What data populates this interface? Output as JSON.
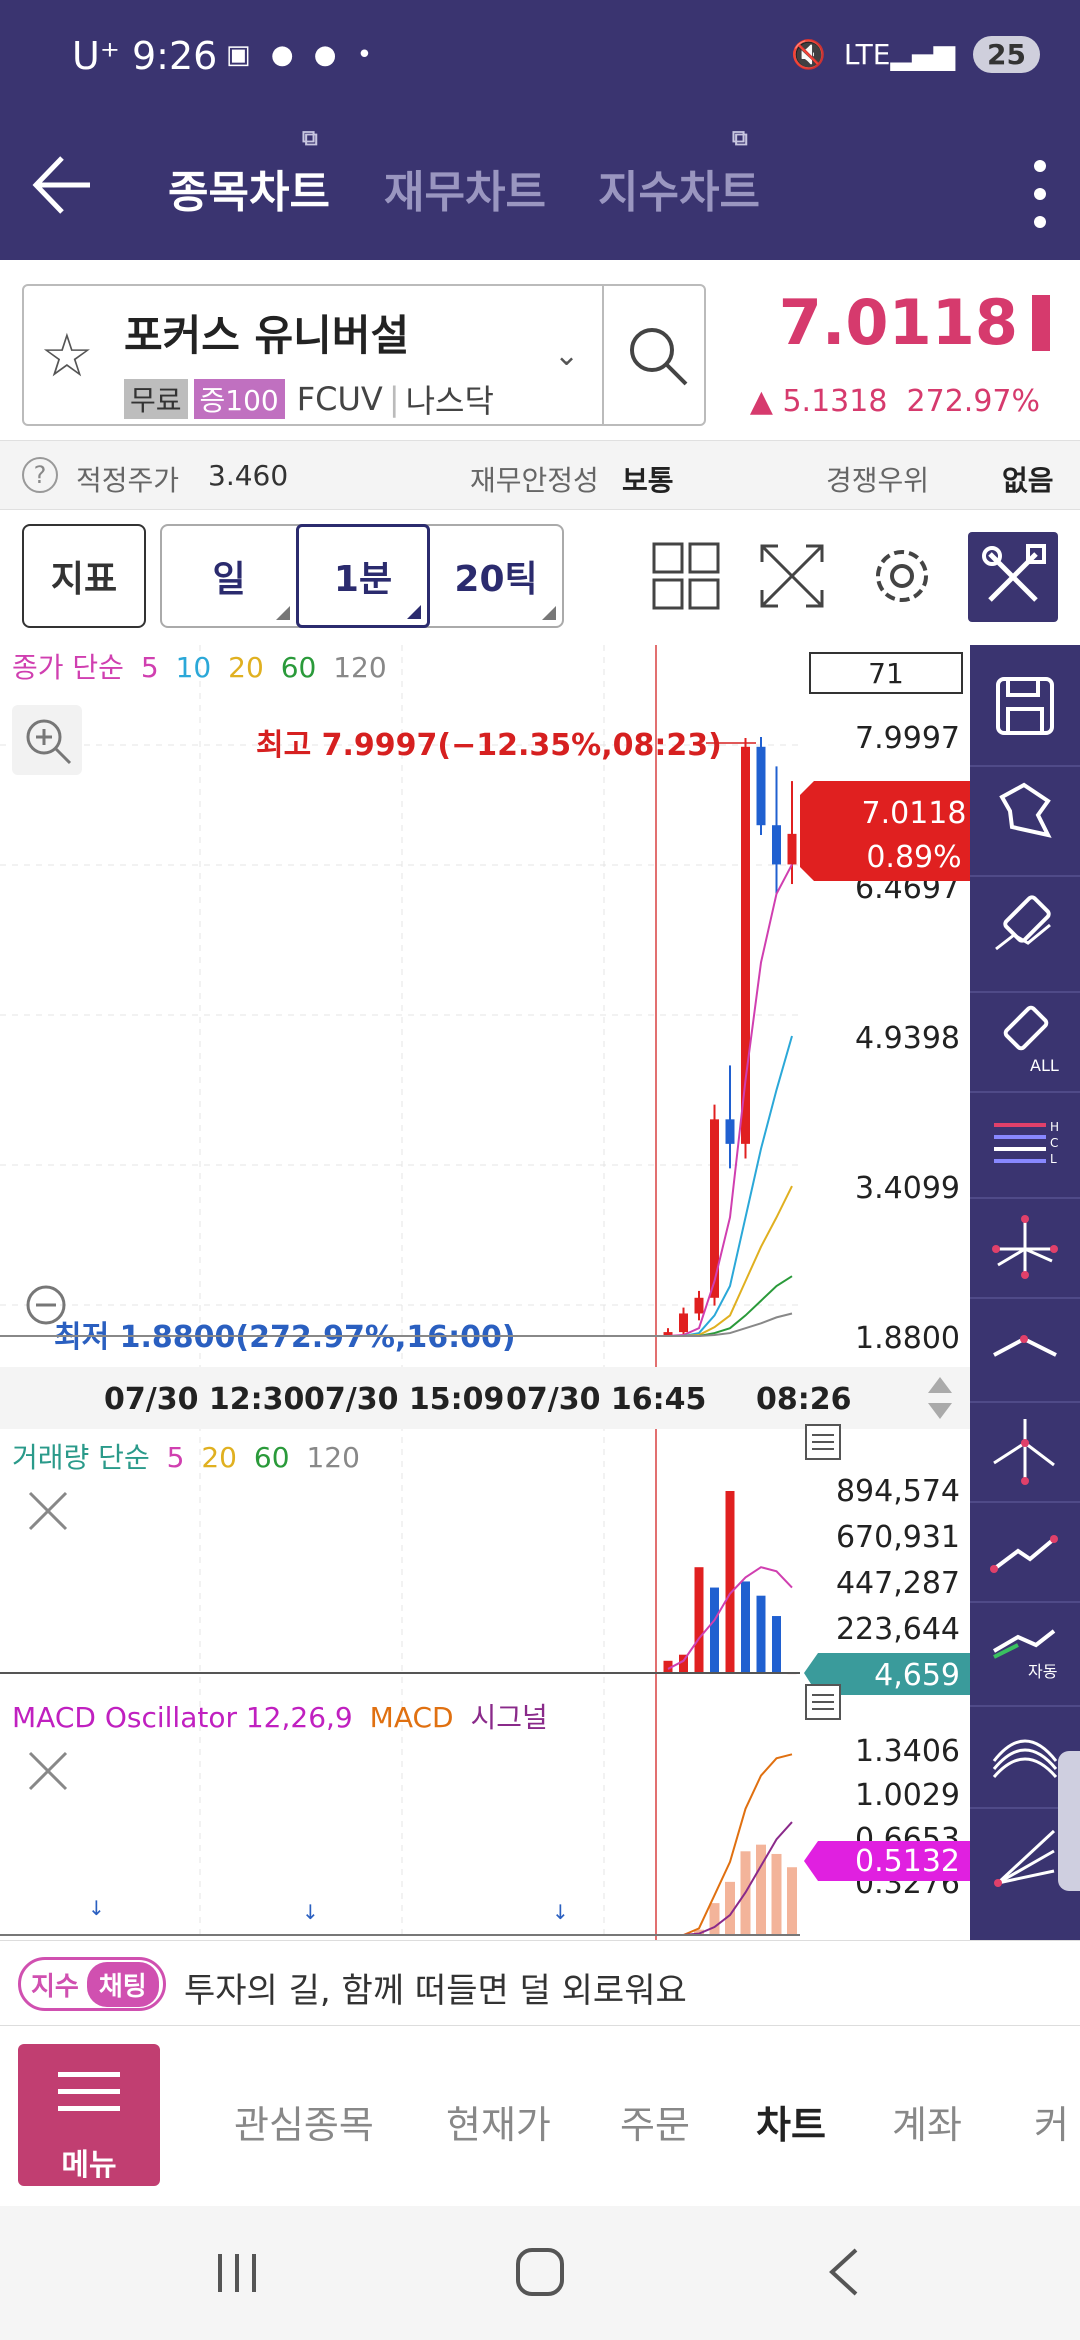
{
  "status": {
    "time": "9:26",
    "carrier": "U⁺",
    "notif_icons": [
      "screenshot-icon",
      "kakaotalk-icon",
      "wear-icon"
    ],
    "battery": "25"
  },
  "appbar": {
    "tabs": [
      {
        "label": "종목차트",
        "active": true
      },
      {
        "label": "재무차트",
        "active": false
      },
      {
        "label": "지수차트",
        "active": false
      }
    ]
  },
  "stock": {
    "name": "포커스 유니버설",
    "tag_free": "무료",
    "tag_margin": "증100",
    "ticker": "FCUV",
    "market": "나스닥",
    "price": "7.0118",
    "change": "5.1318",
    "change_pct": "272.97%",
    "color_up": "#d63a6d"
  },
  "info": {
    "fair_price_label": "적정주가",
    "fair_price_value": "3.460",
    "stability_label": "재무안정성",
    "stability_value": "보통",
    "competition_label": "경쟁우위",
    "competition_value": "없음"
  },
  "toolbar": {
    "indicator": "지표",
    "period_day": "일",
    "period_minute": "1분",
    "period_tick": "20틱"
  },
  "chart_data": {
    "type": "candlestick",
    "price_legend": {
      "prefix": "종가 단순",
      "periods": [
        "5",
        "10",
        "20",
        "60",
        "120"
      ],
      "colors": [
        "#d03fb0",
        "#2ba8d8",
        "#e0b020",
        "#2a9a3a",
        "#888888"
      ]
    },
    "zoom_level": "71",
    "high_annotation": "최고 7.9997(−12.35%,08:23)",
    "low_annotation": "최저 1.8800(272.97%,16:00)",
    "y_axis": [
      "7.9997",
      "6.4697",
      "4.9398",
      "3.4099",
      "1.8800"
    ],
    "ylim": [
      1.88,
      7.9997
    ],
    "current_price_label": "7.0118",
    "current_pct_label": "0.89%",
    "x_axis": [
      "07/30 12:30",
      "07/30 15:09",
      "07/30 16:45",
      "08:26"
    ],
    "candles": [
      {
        "o": 1.9,
        "h": 1.97,
        "l": 1.88,
        "c": 1.93,
        "up": true
      },
      {
        "o": 1.93,
        "h": 2.18,
        "l": 1.91,
        "c": 2.12,
        "up": true
      },
      {
        "o": 2.12,
        "h": 2.35,
        "l": 2.05,
        "c": 2.28,
        "up": true
      },
      {
        "o": 2.28,
        "h": 4.25,
        "l": 2.2,
        "c": 4.1,
        "up": true
      },
      {
        "o": 4.1,
        "h": 4.65,
        "l": 3.6,
        "c": 3.85,
        "up": false
      },
      {
        "o": 3.85,
        "h": 7.99,
        "l": 3.7,
        "c": 7.9,
        "up": true
      },
      {
        "o": 7.9,
        "h": 7.9997,
        "l": 7.0,
        "c": 7.1,
        "up": false
      },
      {
        "o": 7.1,
        "h": 7.7,
        "l": 6.4,
        "c": 6.7,
        "up": false
      },
      {
        "o": 6.7,
        "h": 7.55,
        "l": 6.5,
        "c": 7.0118,
        "up": true
      }
    ],
    "ma": [
      {
        "period": "5",
        "color": "#d03fb0",
        "values": [
          1.89,
          1.9,
          1.97,
          2.45,
          3.1,
          4.5,
          5.7,
          6.4,
          6.7
        ]
      },
      {
        "period": "10",
        "color": "#2ba8d8",
        "values": [
          1.89,
          1.89,
          1.92,
          2.1,
          2.4,
          3.1,
          3.8,
          4.4,
          4.95
        ]
      },
      {
        "period": "20",
        "color": "#e0b020",
        "values": [
          1.89,
          1.89,
          1.9,
          1.98,
          2.1,
          2.45,
          2.8,
          3.1,
          3.42
        ]
      },
      {
        "period": "60",
        "color": "#2a9a3a",
        "values": [
          1.89,
          1.89,
          1.89,
          1.92,
          1.97,
          2.1,
          2.25,
          2.4,
          2.5
        ]
      },
      {
        "period": "120",
        "color": "#888888",
        "values": [
          1.89,
          1.89,
          1.89,
          1.9,
          1.92,
          1.97,
          2.02,
          2.08,
          2.12
        ]
      }
    ],
    "volume_legend": {
      "prefix": "거래량 단순",
      "periods": [
        "5",
        "20",
        "60",
        "120"
      ],
      "colors": [
        "#d03fb0",
        "#e0b020",
        "#2a9a3a",
        "#888888"
      ]
    },
    "volume_axis": [
      "894,574",
      "670,931",
      "447,287",
      "223,644"
    ],
    "volume_current": "4,659",
    "volume": [
      {
        "v": 60000,
        "up": true
      },
      {
        "v": 90000,
        "up": true
      },
      {
        "v": 520000,
        "up": true
      },
      {
        "v": 420000,
        "up": false
      },
      {
        "v": 894574,
        "up": true
      },
      {
        "v": 450000,
        "up": false
      },
      {
        "v": 380000,
        "up": false
      },
      {
        "v": 280000,
        "up": false
      },
      {
        "v": 4659,
        "up": true
      }
    ],
    "macd_legend": {
      "name": "MACD Oscillator 12,26,9",
      "macd": "MACD",
      "signal": "시그널",
      "colors": [
        "#c020c0",
        "#e07010",
        "#8a2a8a"
      ]
    },
    "macd_axis": [
      "1.3406",
      "1.0029",
      "0.6653",
      "0.3276"
    ],
    "macd_current": "0.5132",
    "macd_line": [
      0.0,
      0.0,
      0.05,
      0.3,
      0.55,
      0.95,
      1.2,
      1.33,
      1.36
    ],
    "signal_line": [
      0.0,
      0.0,
      0.01,
      0.06,
      0.15,
      0.32,
      0.52,
      0.72,
      0.85
    ],
    "oscillator": [
      0.0,
      0.0,
      0.04,
      0.24,
      0.4,
      0.63,
      0.68,
      0.61,
      0.51
    ]
  },
  "ticker_bar": {
    "tag1": "지수",
    "tag2": "채팅",
    "text": "투자의 길, 함께 떠들면 덜 외로워요"
  },
  "bottomnav": {
    "menu_label": "메뉴",
    "items": [
      {
        "label": "관심종목",
        "active": false
      },
      {
        "label": "현재가",
        "active": false
      },
      {
        "label": "주문",
        "active": false
      },
      {
        "label": "차트",
        "active": true
      },
      {
        "label": "계좌",
        "active": false
      },
      {
        "label": "커",
        "active": false
      }
    ]
  }
}
